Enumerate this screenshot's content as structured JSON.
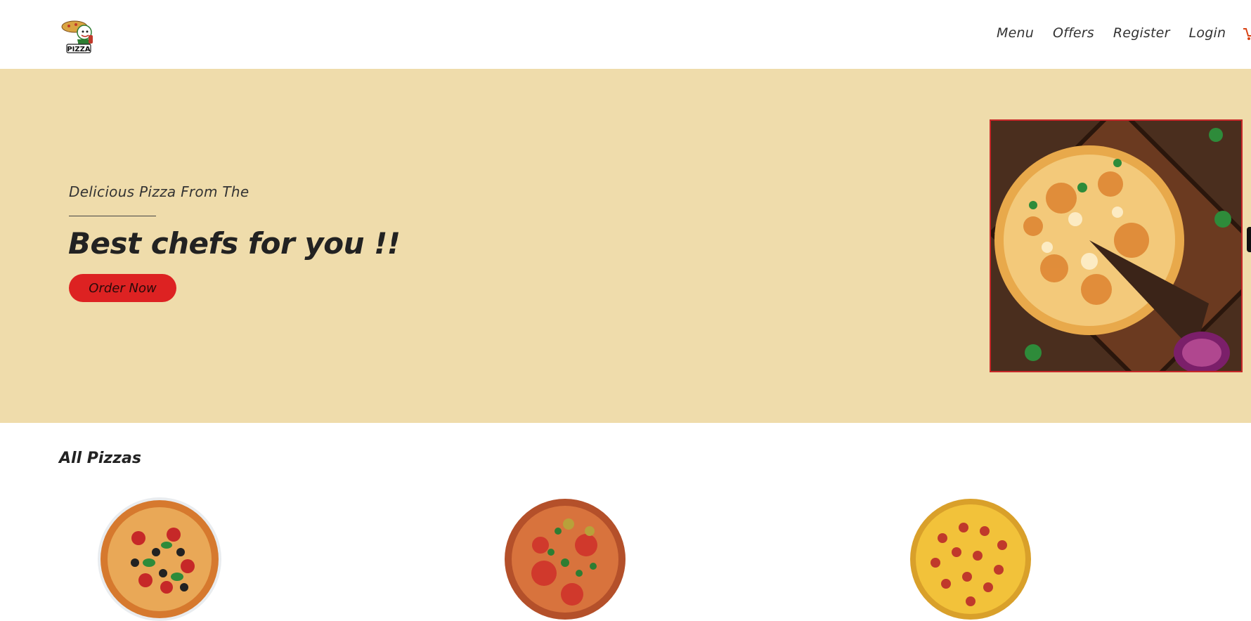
{
  "nav": {
    "links": [
      "Menu",
      "Offers",
      "Register",
      "Login"
    ]
  },
  "logo": {
    "text": "PIZZA"
  },
  "hero": {
    "subtitle": "Delicious Pizza From The",
    "title": "Best chefs for you !!",
    "cta": "Order Now"
  },
  "pizzas": {
    "title": "All Pizzas"
  },
  "colors": {
    "hero_bg": "#efdcab",
    "accent": "#dd2222"
  }
}
